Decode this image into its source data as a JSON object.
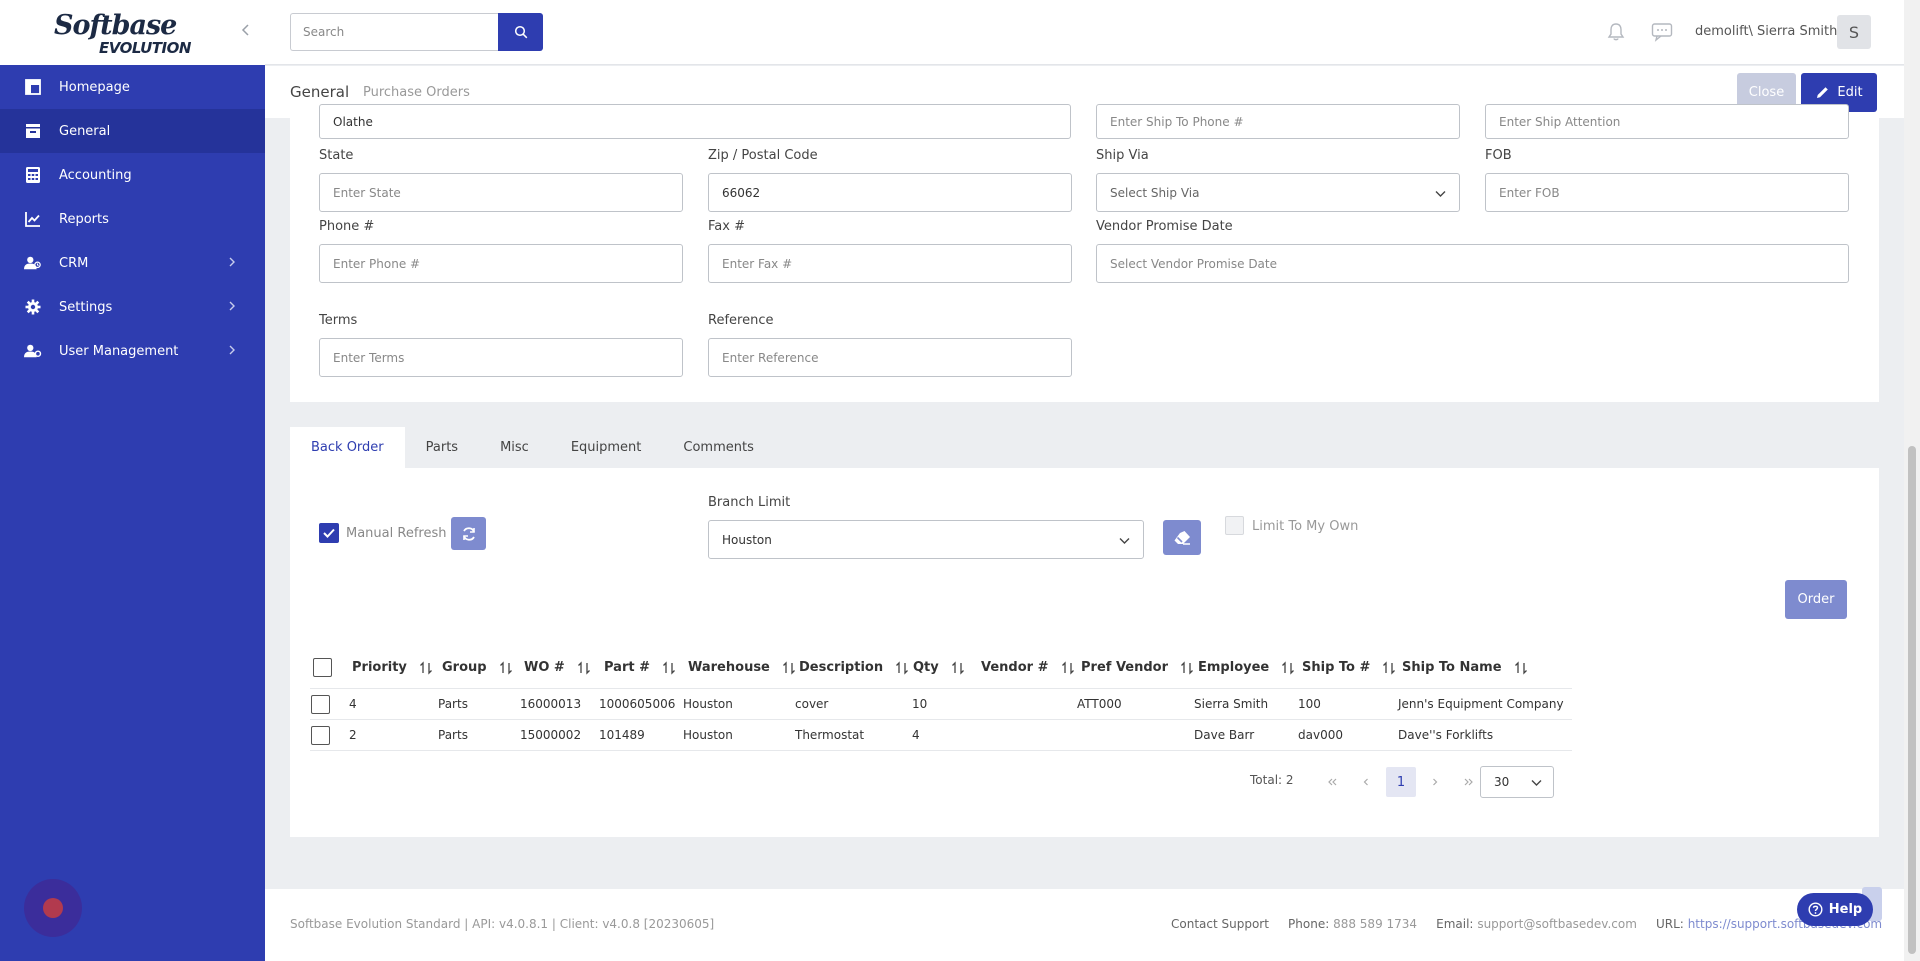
{
  "sidebar": {
    "logo_top": "Softbase",
    "logo_bottom": "EVOLUTION",
    "items": [
      {
        "label": "Homepage",
        "icon": "grid-icon"
      },
      {
        "label": "General",
        "icon": "inbox-icon"
      },
      {
        "label": "Accounting",
        "icon": "calculator-icon"
      },
      {
        "label": "Reports",
        "icon": "chart-icon"
      },
      {
        "label": "CRM",
        "icon": "users-icon"
      },
      {
        "label": "Settings",
        "icon": "gear-icon"
      },
      {
        "label": "User Management",
        "icon": "user-gear-icon"
      }
    ]
  },
  "topbar": {
    "search_placeholder": "Search",
    "username": "demolift\\ Sierra Smith",
    "avatar_letter": "S"
  },
  "subheader": {
    "tab_general": "General",
    "tab_purchase_orders": "Purchase Orders",
    "close_label": "Close",
    "edit_label": "Edit"
  },
  "form": {
    "city_value": "Olathe",
    "ship_to_phone_placeholder": "Enter Ship To Phone #",
    "ship_attention_placeholder": "Enter Ship Attention",
    "state_label": "State",
    "state_placeholder": "Enter State",
    "zip_label": "Zip / Postal Code",
    "zip_value": "66062",
    "ship_via_label": "Ship Via",
    "ship_via_placeholder": "Select Ship Via",
    "fob_label": "FOB",
    "fob_placeholder": "Enter FOB",
    "phone_label": "Phone #",
    "phone_placeholder": "Enter Phone #",
    "fax_label": "Fax #",
    "fax_placeholder": "Enter Fax #",
    "vendor_promise_label": "Vendor Promise Date",
    "vendor_promise_placeholder": "Select Vendor Promise Date",
    "terms_label": "Terms",
    "terms_placeholder": "Enter Terms",
    "reference_label": "Reference",
    "reference_placeholder": "Enter Reference"
  },
  "tabs": [
    "Back Order",
    "Parts",
    "Misc",
    "Equipment",
    "Comments"
  ],
  "back_order": {
    "manual_refresh_label": "Manual Refresh",
    "branch_limit_label": "Branch Limit",
    "branch_value": "Houston",
    "limit_to_my_own_label": "Limit To My Own",
    "order_label": "Order"
  },
  "table": {
    "columns": [
      "Priority",
      "Group",
      "WO #",
      "Part #",
      "Warehouse",
      "Description",
      "Qty",
      "Vendor #",
      "Pref Vendor",
      "Employee",
      "Ship To #",
      "Ship To Name"
    ],
    "rows": [
      [
        "4",
        "Parts",
        "16000013",
        "1000605006",
        "Houston",
        "cover",
        "10",
        "",
        "ATT000",
        "Sierra Smith",
        "100",
        "Jenn's Equipment Company"
      ],
      [
        "2",
        "Parts",
        "15000002",
        "101489",
        "Houston",
        "Thermostat",
        "4",
        "",
        "",
        "Dave Barr",
        "dav000",
        "Dave''s Forklifts"
      ]
    ]
  },
  "pager": {
    "total": "Total: 2",
    "current_page": "1",
    "page_size": "30"
  },
  "footer": {
    "left": "Softbase Evolution Standard | API: v4.0.8.1 | Client: v4.0.8 [20230605]",
    "contact": "Contact Support",
    "phone_label": "Phone:",
    "phone": "888 589 1734",
    "email_label": "Email:",
    "email": "support@softbasedev.com",
    "url_label": "URL:",
    "url": "https://support.softbasedev.com",
    "help": "Help"
  },
  "colors": {
    "brand": "#2e3db0",
    "brand_light": "#7e8bcf"
  }
}
